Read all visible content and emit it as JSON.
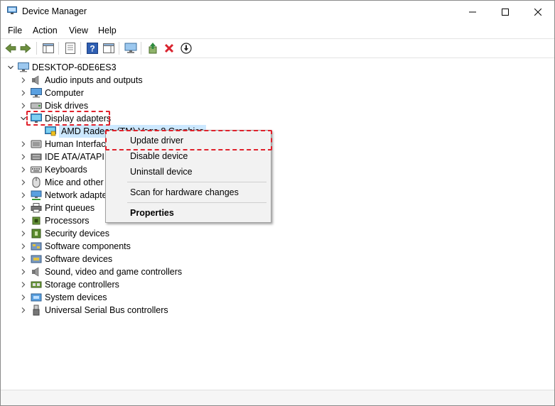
{
  "window": {
    "title": "Device Manager",
    "minimize_icon": "minimize-icon",
    "maximize_icon": "maximize-icon",
    "close_icon": "close-icon"
  },
  "menu": [
    "File",
    "Action",
    "View",
    "Help"
  ],
  "toolbar": [
    "back-icon",
    "forward-icon",
    "show-hide-console-tree-icon",
    "properties-icon",
    "help-icon",
    "action-pane-icon",
    "monitor-icon",
    "update-driver-icon",
    "uninstall-icon",
    "download-icon"
  ],
  "tree": {
    "root": "DESKTOP-6DE6ES3",
    "categories": [
      {
        "label": "Audio inputs and outputs",
        "icon": "speaker-icon"
      },
      {
        "label": "Computer",
        "icon": "computer-icon"
      },
      {
        "label": "Disk drives",
        "icon": "disk-icon"
      },
      {
        "label": "Display adapters",
        "icon": "display-icon",
        "expanded": true,
        "children": [
          "AMD Radeon (TM) Vega 8 Graphics"
        ]
      },
      {
        "label": "Human Interface Devices",
        "icon": "hid-icon"
      },
      {
        "label": "IDE ATA/ATAPI controllers",
        "icon": "ide-icon"
      },
      {
        "label": "Keyboards",
        "icon": "keyboard-icon"
      },
      {
        "label": "Mice and other pointing devices",
        "icon": "mouse-icon"
      },
      {
        "label": "Network adapters",
        "icon": "network-icon"
      },
      {
        "label": "Print queues",
        "icon": "printer-icon"
      },
      {
        "label": "Processors",
        "icon": "processor-icon"
      },
      {
        "label": "Security devices",
        "icon": "security-icon"
      },
      {
        "label": "Software components",
        "icon": "software-component-icon"
      },
      {
        "label": "Software devices",
        "icon": "software-device-icon"
      },
      {
        "label": "Sound, video and game controllers",
        "icon": "sound-icon"
      },
      {
        "label": "Storage controllers",
        "icon": "storage-icon"
      },
      {
        "label": "System devices",
        "icon": "system-icon"
      },
      {
        "label": "Universal Serial Bus controllers",
        "icon": "usb-icon"
      }
    ]
  },
  "context_menu": {
    "update_driver": "Update driver",
    "disable_device": "Disable device",
    "uninstall_device": "Uninstall device",
    "scan_changes": "Scan for hardware changes",
    "properties": "Properties"
  },
  "colors": {
    "highlight": "#e0212b",
    "selection": "#cce8ff",
    "menu_bg": "#f2f2f2"
  }
}
